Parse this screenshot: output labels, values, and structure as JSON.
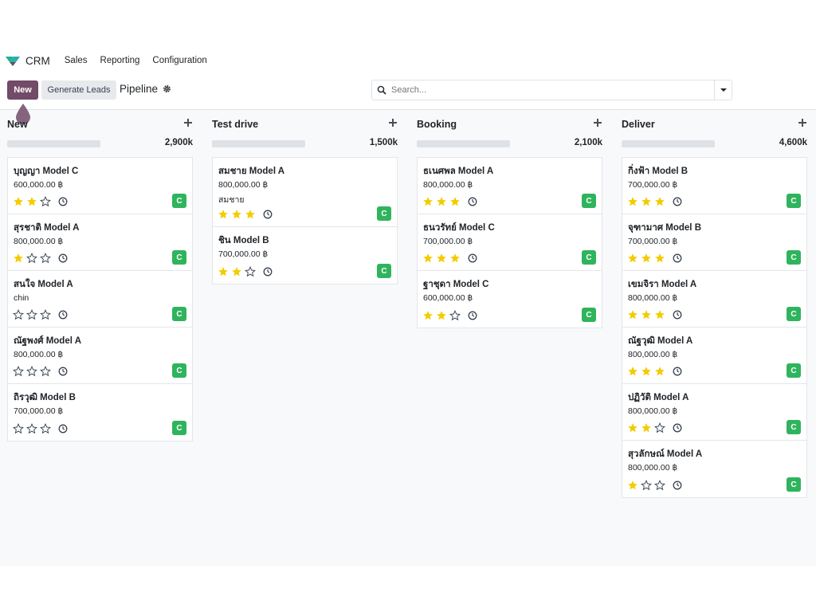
{
  "navbar": {
    "app_name": "CRM",
    "menu": [
      "Sales",
      "Reporting",
      "Configuration"
    ]
  },
  "control_panel": {
    "new_label": "New",
    "generate_label": "Generate Leads",
    "breadcrumb": "Pipeline",
    "search_placeholder": "Search..."
  },
  "colors": {
    "primary": "#714b67",
    "avatar": "#2fb45d",
    "star": "#f3cc00"
  },
  "columns": [
    {
      "title": "New",
      "total": "2,900k",
      "cards": [
        {
          "name": "บุญญา Model C",
          "revenue": "600,000.00 ฿",
          "sub": "",
          "stars": 2,
          "avatar": "C"
        },
        {
          "name": "สุรชาติ Model A",
          "revenue": "800,000.00 ฿",
          "sub": "",
          "stars": 1,
          "avatar": "C"
        },
        {
          "name": "สนใจ Model A",
          "revenue": "chin",
          "sub": "",
          "stars": 0,
          "avatar": "C"
        },
        {
          "name": "ณัฐพงศ์ Model A",
          "revenue": "800,000.00 ฿",
          "sub": "",
          "stars": 0,
          "avatar": "C"
        },
        {
          "name": "ถิรวุฒิ Model B",
          "revenue": "700,000.00 ฿",
          "sub": "",
          "stars": 0,
          "avatar": "C"
        }
      ]
    },
    {
      "title": "Test drive",
      "total": "1,500k",
      "cards": [
        {
          "name": "สมชาย Model A",
          "revenue": "800,000.00 ฿",
          "sub": "สมชาย",
          "stars": 3,
          "avatar": "C"
        },
        {
          "name": "ชิน Model B",
          "revenue": "700,000.00 ฿",
          "sub": "",
          "stars": 2,
          "avatar": "C"
        }
      ]
    },
    {
      "title": "Booking",
      "total": "2,100k",
      "cards": [
        {
          "name": "ธเนศพล Model A",
          "revenue": "800,000.00 ฿",
          "sub": "",
          "stars": 3,
          "avatar": "C"
        },
        {
          "name": "ธนวรัทย์ Model C",
          "revenue": "700,000.00 ฿",
          "sub": "",
          "stars": 3,
          "avatar": "C"
        },
        {
          "name": "ฐาชุดา Model C",
          "revenue": "600,000.00 ฿",
          "sub": "",
          "stars": 2,
          "avatar": "C"
        }
      ]
    },
    {
      "title": "Deliver",
      "total": "4,600k",
      "cards": [
        {
          "name": "กิ่งฟ้า Model B",
          "revenue": "700,000.00 ฿",
          "sub": "",
          "stars": 3,
          "avatar": "C"
        },
        {
          "name": "จุฑามาศ Model B",
          "revenue": "700,000.00 ฿",
          "sub": "",
          "stars": 3,
          "avatar": "C"
        },
        {
          "name": "เขมจิรา Model A",
          "revenue": "800,000.00 ฿",
          "sub": "",
          "stars": 3,
          "avatar": "C"
        },
        {
          "name": "ณัฐวุฒิ Model A",
          "revenue": "800,000.00 ฿",
          "sub": "",
          "stars": 3,
          "avatar": "C"
        },
        {
          "name": "ปฏิวัติ Model A",
          "revenue": "800,000.00 ฿",
          "sub": "",
          "stars": 2,
          "avatar": "C"
        },
        {
          "name": "สุวลักษณ์ Model A",
          "revenue": "800,000.00 ฿",
          "sub": "",
          "stars": 1,
          "avatar": "C"
        }
      ]
    }
  ]
}
